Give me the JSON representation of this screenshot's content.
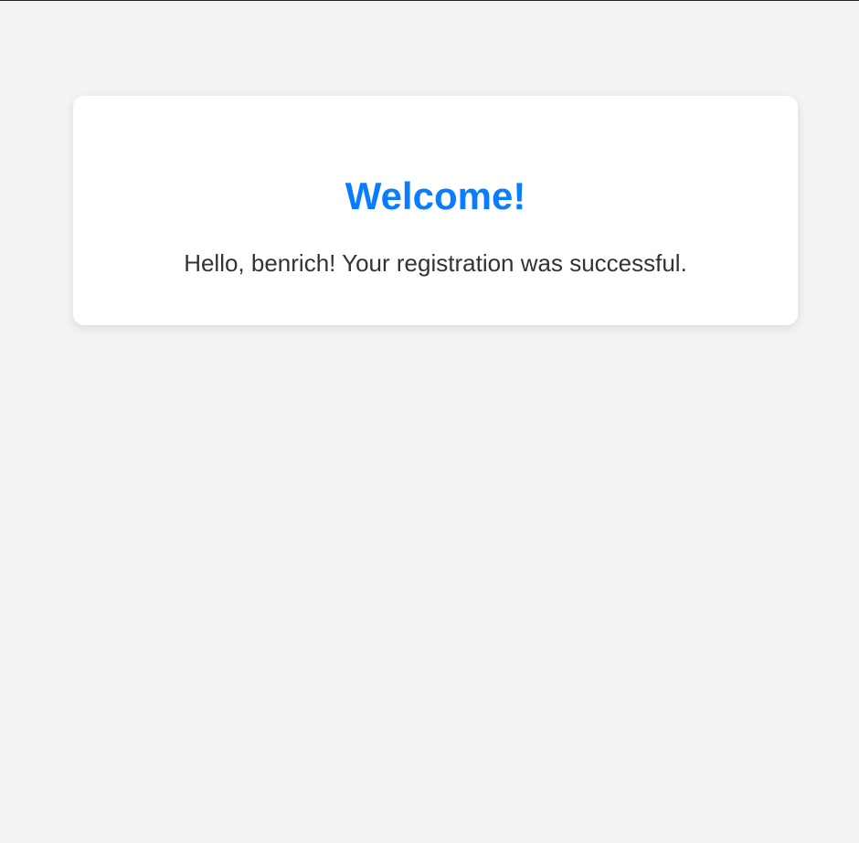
{
  "card": {
    "title": "Welcome!",
    "message": "Hello, benrich! Your registration was successful."
  },
  "colors": {
    "background": "#f3f3f3",
    "card": "#ffffff",
    "title": "#0a7cff",
    "text": "#333333"
  }
}
